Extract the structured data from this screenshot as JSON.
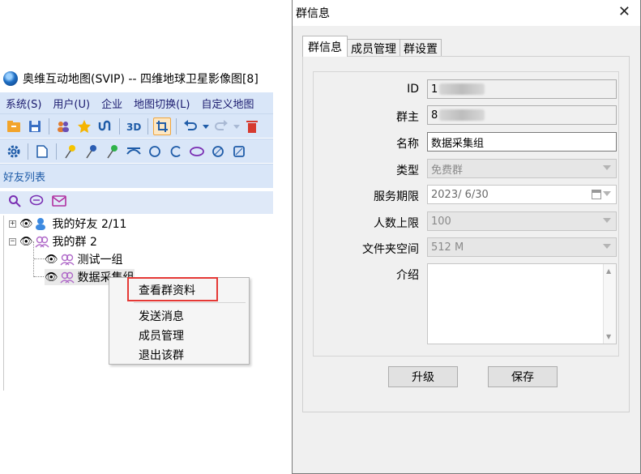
{
  "app": {
    "title": "奥维互动地图(SVIP) -- 四维地球卫星影像图[8]",
    "menu": [
      "系统(S)",
      "用户(U)",
      "企业",
      "地图切换(L)",
      "自定义地图"
    ],
    "panel_title": "好友列表",
    "tree": {
      "friends_label": "我的好友 2/11",
      "groups_label": "我的群 2",
      "group_items": [
        "测试一组",
        "数据采集组"
      ]
    },
    "context_menu": {
      "items": [
        "查看群资料",
        "发送消息",
        "成员管理",
        "退出该群"
      ]
    }
  },
  "dialog": {
    "title": "群信息",
    "close_icon": "close-icon",
    "tabs": [
      "群信息",
      "成员管理",
      "群设置"
    ],
    "fields": {
      "id_label": "ID",
      "id_value": "1",
      "owner_label": "群主",
      "owner_value": "8",
      "name_label": "名称",
      "name_value": "数据采集组",
      "type_label": "类型",
      "type_value": "免费群",
      "service_label": "服务期限",
      "service_value": "2023/  6/30",
      "size_label": "人数上限",
      "size_value": "100",
      "folder_label": "文件夹空间",
      "folder_value": "512 M",
      "intro_label": "介绍",
      "intro_value": ""
    },
    "buttons": {
      "upgrade": "升级",
      "save": "保存"
    }
  },
  "colors": {
    "highlight": "#e53935",
    "menubar": "#d9e6f8",
    "accent": "#1f5ca8"
  }
}
